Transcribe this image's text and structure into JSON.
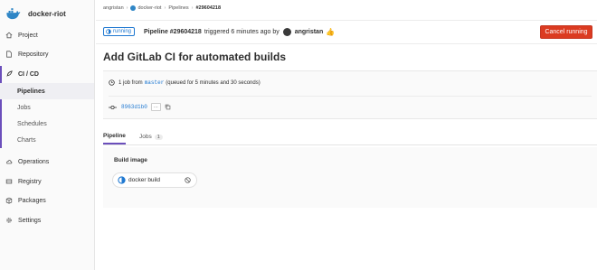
{
  "project": {
    "name": "docker-riot"
  },
  "sidebar": {
    "items": [
      {
        "label": "Project",
        "icon": "home-icon"
      },
      {
        "label": "Repository",
        "icon": "file-icon"
      },
      {
        "label": "CI / CD",
        "icon": "rocket-icon"
      },
      {
        "label": "Operations",
        "icon": "cloud-icon"
      },
      {
        "label": "Registry",
        "icon": "container-icon"
      },
      {
        "label": "Packages",
        "icon": "package-icon"
      },
      {
        "label": "Settings",
        "icon": "gear-icon"
      }
    ],
    "cicd_sub": [
      "Pipelines",
      "Jobs",
      "Schedules",
      "Charts"
    ]
  },
  "breadcrumb": {
    "user": "angristan",
    "project": "docker-riot",
    "section": "Pipelines",
    "current": "#29604218"
  },
  "header": {
    "status": "running",
    "pipeline_label": "Pipeline #29604218",
    "triggered_text": "triggered 6 minutes ago by",
    "author": "angristan",
    "cancel_label": "Cancel running"
  },
  "title": "Add GitLab CI for automated builds",
  "info": {
    "jobs_prefix": "1 job from",
    "branch": "master",
    "queued_text": "(queued for 5 minutes and 30 seconds)",
    "sha": "8963d1b0",
    "ellipsis": "···"
  },
  "tabs": {
    "pipeline_label": "Pipeline",
    "jobs_label": "Jobs",
    "jobs_count": "1"
  },
  "stage": {
    "title": "Build image",
    "job_name": "docker build"
  },
  "colors": {
    "accent": "#6b4fbb",
    "link": "#1f78d1",
    "danger": "#db3b21"
  }
}
